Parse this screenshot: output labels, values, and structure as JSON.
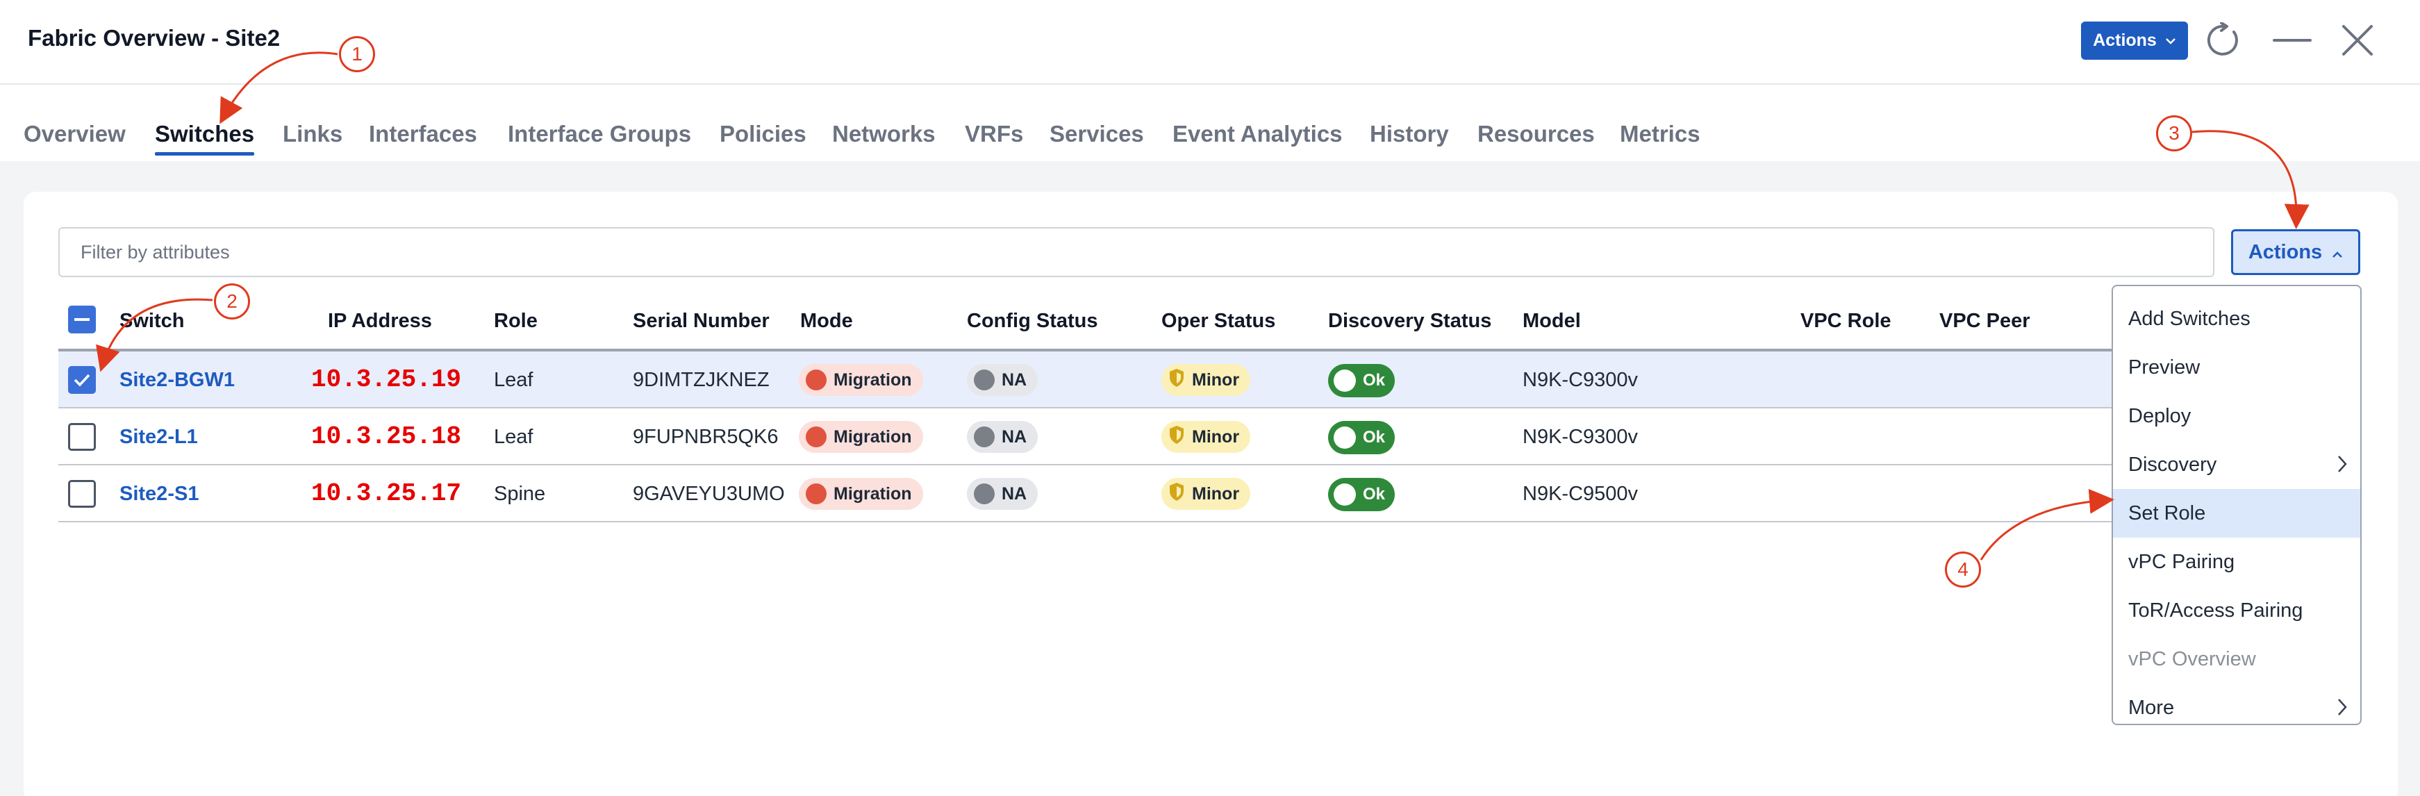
{
  "window": {
    "title": "Fabric Overview - Site2",
    "actions_label": "Actions"
  },
  "tabs": [
    {
      "label": "Overview"
    },
    {
      "label": "Switches",
      "active": true
    },
    {
      "label": "Links"
    },
    {
      "label": "Interfaces"
    },
    {
      "label": "Interface Groups"
    },
    {
      "label": "Policies"
    },
    {
      "label": "Networks"
    },
    {
      "label": "VRFs"
    },
    {
      "label": "Services"
    },
    {
      "label": "Event Analytics"
    },
    {
      "label": "History"
    },
    {
      "label": "Resources"
    },
    {
      "label": "Metrics"
    }
  ],
  "filter": {
    "placeholder": "Filter by attributes",
    "value": ""
  },
  "panel_actions_label": "Actions",
  "table": {
    "columns": [
      "Switch",
      "IP Address",
      "Role",
      "Serial Number",
      "Mode",
      "Config Status",
      "Oper Status",
      "Discovery Status",
      "Model",
      "VPC Role",
      "VPC Peer"
    ],
    "rows": [
      {
        "switch": "Site2-BGW1",
        "ip": "10.3.25.19",
        "role": "Leaf",
        "serial": "9DIMTZJKNEZ",
        "mode": "Migration",
        "config_status": "NA",
        "oper_status": "Minor",
        "discovery_status": "Ok",
        "model": "N9K-C9300v",
        "vpc_role": "",
        "vpc_peer": "",
        "checked": true
      },
      {
        "switch": "Site2-L1",
        "ip": "10.3.25.18",
        "role": "Leaf",
        "serial": "9FUPNBR5QK6",
        "mode": "Migration",
        "config_status": "NA",
        "oper_status": "Minor",
        "discovery_status": "Ok",
        "model": "N9K-C9300v",
        "vpc_role": "",
        "vpc_peer": "",
        "checked": false
      },
      {
        "switch": "Site2-S1",
        "ip": "10.3.25.17",
        "role": "Spine",
        "serial": "9GAVEYU3UMO",
        "mode": "Migration",
        "config_status": "NA",
        "oper_status": "Minor",
        "discovery_status": "Ok",
        "model": "N9K-C9500v",
        "vpc_role": "",
        "vpc_peer": "",
        "checked": false
      }
    ]
  },
  "actions_menu": {
    "items": [
      {
        "label": "Add Switches"
      },
      {
        "label": "Preview"
      },
      {
        "label": "Deploy"
      },
      {
        "label": "Discovery",
        "submenu": true
      },
      {
        "label": "Set Role",
        "highlighted": true
      },
      {
        "label": "vPC Pairing"
      },
      {
        "label": "ToR/Access Pairing"
      },
      {
        "label": "vPC Overview",
        "disabled": true
      },
      {
        "label": "More",
        "submenu": true
      }
    ]
  },
  "annotations": [
    "1",
    "2",
    "3",
    "4"
  ],
  "colors": {
    "accent": "#1d5bbf",
    "annotation": "#e03a1e",
    "ip_text": "#e60000",
    "ok_green": "#2e8a3a",
    "migration_red": "#e0533f"
  }
}
